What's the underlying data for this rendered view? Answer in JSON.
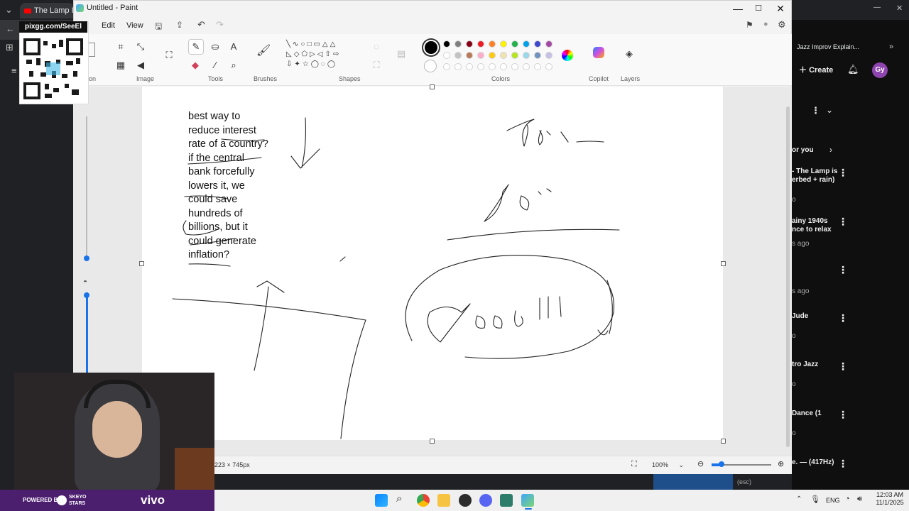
{
  "browser": {
    "tab_title": "The Lamp Is Lo",
    "sidebar_video_title": "Jazz Improv Explain...",
    "create_label": "Create",
    "avatar_initials": "Gy",
    "for_you_label": "or you",
    "items": [
      {
        "title1": "- The Lamp is",
        "title2": "erbed + rain)",
        "meta": "o"
      },
      {
        "title1": "ainy 1940s",
        "title2": "nce to relax",
        "meta": "s ago"
      },
      {
        "title1": "",
        "title2": "",
        "meta": "s ago"
      },
      {
        "title1": "Jude",
        "title2": "",
        "meta": "o"
      },
      {
        "title1": "tro Jazz",
        "title2": "",
        "meta": "o"
      },
      {
        "title1": "Dance (1",
        "title2": "",
        "meta": "o"
      },
      {
        "title1": "e. — (417Hz)",
        "title2": "",
        "meta": ""
      }
    ],
    "esc_hint": "(esc)"
  },
  "overlay": {
    "qr_label": "pixgg.com/SeeEl",
    "powered_by": "POWERED BY",
    "brand1": "SKEYO STARS",
    "brand2": "vivo"
  },
  "paint": {
    "title": "Untitled - Paint",
    "menu": {
      "edit": "Edit",
      "view": "View"
    },
    "groups": {
      "selection": "ction",
      "image": "Image",
      "tools": "Tools",
      "brushes": "Brushes",
      "shapes": "Shapes",
      "colors": "Colors",
      "copilot": "Copilot",
      "layers": "Layers"
    },
    "canvas_text": [
      "best way to",
      "reduce interest",
      "rate of a country?",
      "if the central",
      "bank forcefully",
      "lowers it, we",
      "could save",
      "hundreds of",
      "billions, but it",
      "could generate",
      "inflation?"
    ],
    "status": {
      "dimensions": "223 × 745px",
      "zoom": "100%"
    },
    "colors": {
      "row1": [
        "#000000",
        "#7f7f7f",
        "#880015",
        "#ed1c24",
        "#ff7f27",
        "#fff200",
        "#22b14c",
        "#00a2e8",
        "#3f48cc",
        "#a349a4"
      ],
      "row2": [
        "#ffffff",
        "#c3c3c3",
        "#b97a57",
        "#ffaec9",
        "#ffc90e",
        "#efe4b0",
        "#b5e61d",
        "#99d9ea",
        "#7092be",
        "#c8bfe7"
      ],
      "primary": "#000000",
      "secondary": "#ffffff"
    }
  },
  "taskbar": {
    "lang": "ENG",
    "time": "12:03 AM",
    "date": "11/1/2025"
  }
}
